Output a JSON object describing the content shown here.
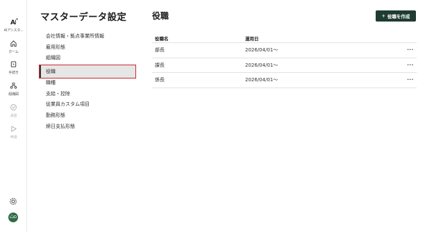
{
  "rail": {
    "items": [
      {
        "label": "AIアシスタ...",
        "icon": "ai-icon"
      },
      {
        "label": "ホーム",
        "icon": "home-icon"
      },
      {
        "label": "手続き",
        "icon": "procedure-icon"
      },
      {
        "label": "組織図",
        "icon": "org-chart-icon"
      },
      {
        "label": "承認",
        "icon": "approve-icon"
      },
      {
        "label": "申請",
        "icon": "send-icon"
      }
    ],
    "avatar": "ѼΩ"
  },
  "settings_panel": {
    "title": "マスターデータ設定",
    "menu": [
      "会社情報・拠点事業所情報",
      "雇用形態",
      "組織図",
      "役職",
      "職種",
      "支給・控除",
      "従業員カスタム項目",
      "勤務形態",
      "締日支払形態"
    ],
    "active_index": 3
  },
  "main": {
    "title": "役職",
    "create_button": "役職を作成",
    "table": {
      "headers": [
        "役職名",
        "運用日"
      ],
      "rows": [
        {
          "name": "部長",
          "date": "2026/04/01〜",
          "more": "···"
        },
        {
          "name": "課長",
          "date": "2026/04/01〜",
          "more": "···"
        },
        {
          "name": "係長",
          "date": "2026/04/01〜",
          "more": "···"
        }
      ]
    }
  },
  "colors": {
    "brand": "#1f3b32",
    "highlight": "#c7282b",
    "active_bg": "#e6e6e6"
  }
}
